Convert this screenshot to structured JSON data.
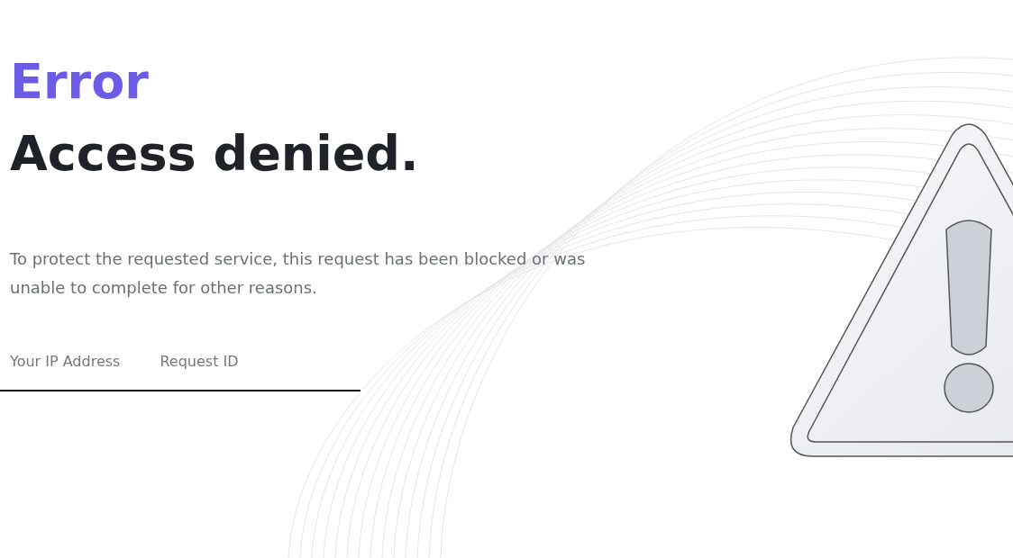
{
  "eyebrow": "Error",
  "title": "Access denied.",
  "message": "To protect the requested service, this request has been blocked or was unable to complete for other reasons.",
  "details": [
    {
      "label": "Your IP Address"
    },
    {
      "label": "Request ID"
    }
  ]
}
